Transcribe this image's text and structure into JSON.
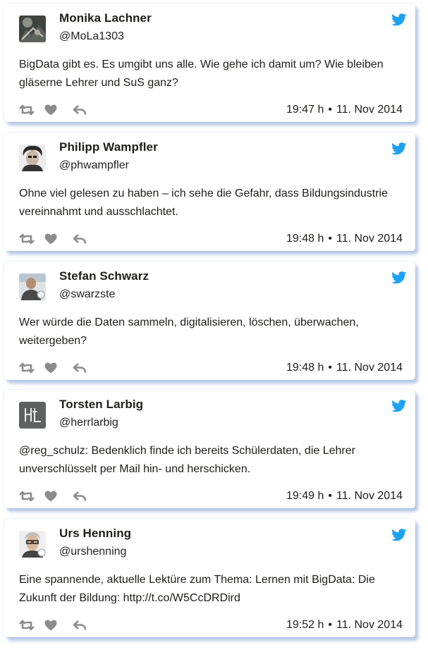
{
  "brand_color": "#1da1f2",
  "icon_color": "#8c8c8c",
  "tweets": [
    {
      "name": "Monika Lachner",
      "handle": "@MoLa1303",
      "text": "BigData gibt es. Es umgibt uns alle. Wie gehe ich damit um? Wie bleiben gläserne Lehrer und SuS ganz?",
      "time": "19:47 h",
      "date": "11. Nov 2014"
    },
    {
      "name": "Philipp Wampfler",
      "handle": "@phwampfler",
      "text": "Ohne viel gelesen zu haben – ich sehe die Gefahr, dass Bildungsindustrie vereinnahmt und ausschlachtet.",
      "time": "19:48 h",
      "date": "11. Nov 2014"
    },
    {
      "name": "Stefan Schwarz",
      "handle": "@swarzste",
      "text": "Wer würde die Daten sammeln, digitalisieren, löschen, überwachen, weitergeben?",
      "time": "19:48 h",
      "date": "11. Nov 2014"
    },
    {
      "name": "Torsten Larbig",
      "handle": "@herrlarbig",
      "text": "@reg_schulz: Bedenklich finde ich bereits Schülerdaten, die Lehrer unverschlüsselt per Mail hin- und herschicken.",
      "time": "19:49 h",
      "date": "11. Nov 2014"
    },
    {
      "name": "Urs Henning",
      "handle": "@urshenning",
      "text": "Eine spannende, aktuelle Lektüre zum Thema: Lernen mit BigData: Die Zukunft der Bildung: http://t.co/W5CcDRDird",
      "time": "19:52 h",
      "date": "11. Nov 2014"
    }
  ]
}
